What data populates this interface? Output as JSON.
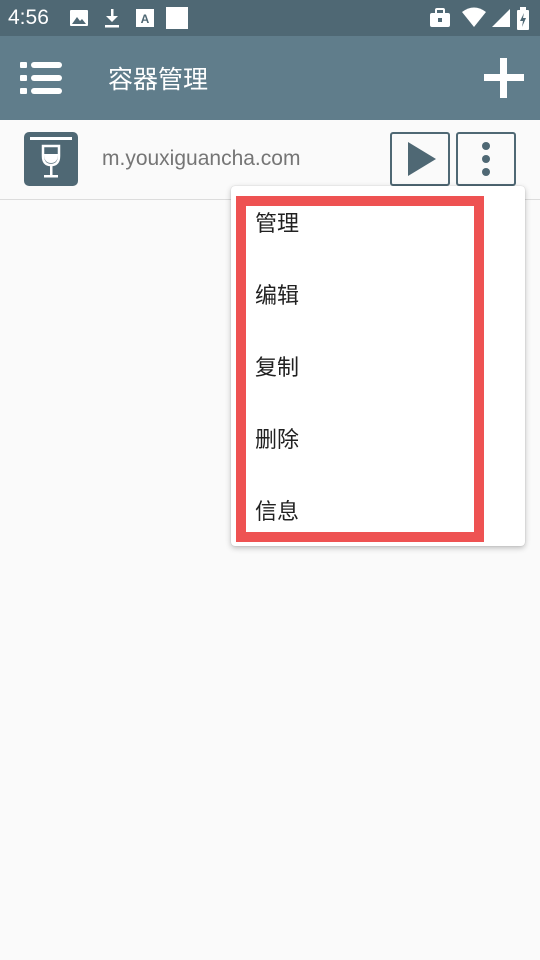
{
  "status_bar": {
    "time": "4:56"
  },
  "app_bar": {
    "title": "容器管理",
    "menu_icon": "list-menu-icon",
    "add_icon": "plus-icon"
  },
  "container": {
    "name": "m.youxiguancha.com",
    "icon": "wine-glass-box-icon"
  },
  "popup_menu": {
    "items": [
      "管理",
      "编辑",
      "复制",
      "删除",
      "信息"
    ]
  },
  "colors": {
    "status_bar": "#4f6874",
    "app_bar": "#607d8b",
    "highlight": "#ee5252"
  }
}
